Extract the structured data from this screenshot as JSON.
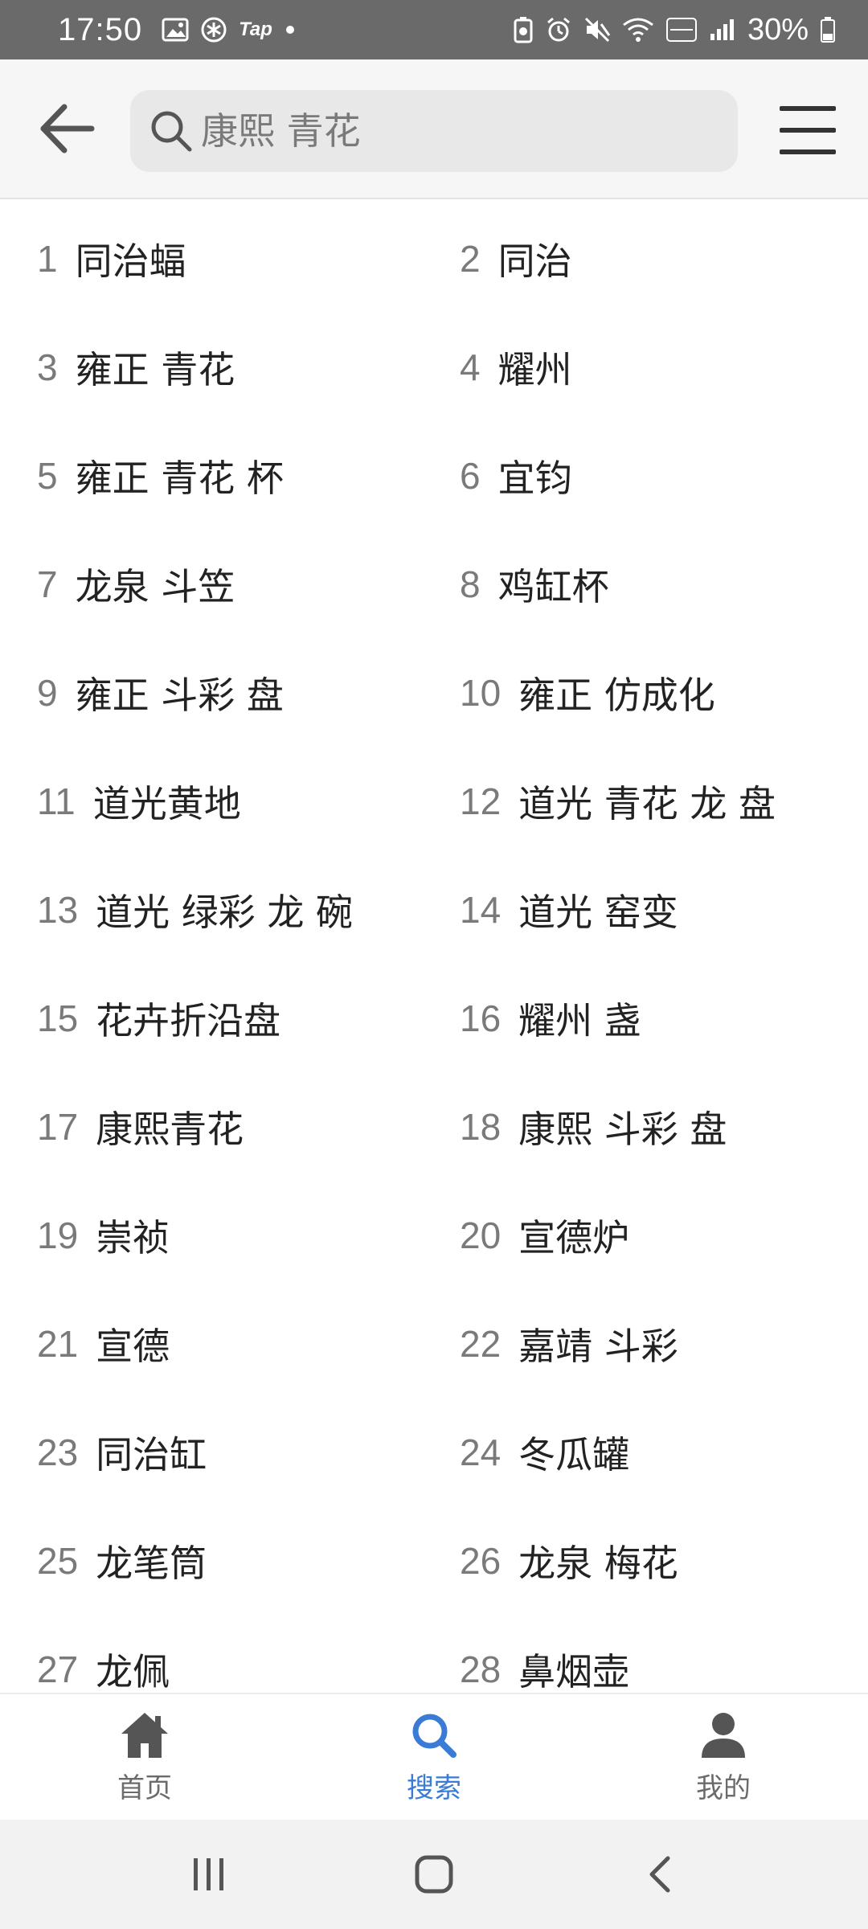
{
  "status_bar": {
    "time": "17:50",
    "tap_label": "Tap",
    "battery": "30%"
  },
  "header": {
    "search_placeholder": "康熙 青花"
  },
  "list": {
    "items": [
      {
        "num": "1",
        "label": "同治蝠"
      },
      {
        "num": "2",
        "label": "同治"
      },
      {
        "num": "3",
        "label": "雍正 青花"
      },
      {
        "num": "4",
        "label": "耀州"
      },
      {
        "num": "5",
        "label": "雍正 青花 杯"
      },
      {
        "num": "6",
        "label": "宜钧"
      },
      {
        "num": "7",
        "label": "龙泉 斗笠"
      },
      {
        "num": "8",
        "label": "鸡缸杯"
      },
      {
        "num": "9",
        "label": "雍正 斗彩 盘"
      },
      {
        "num": "10",
        "label": "雍正 仿成化"
      },
      {
        "num": "11",
        "label": "道光黄地"
      },
      {
        "num": "12",
        "label": "道光 青花 龙 盘"
      },
      {
        "num": "13",
        "label": "道光 绿彩 龙 碗"
      },
      {
        "num": "14",
        "label": "道光 窑变"
      },
      {
        "num": "15",
        "label": "花卉折沿盘"
      },
      {
        "num": "16",
        "label": "耀州 盏"
      },
      {
        "num": "17",
        "label": "康熙青花"
      },
      {
        "num": "18",
        "label": "康熙 斗彩 盘"
      },
      {
        "num": "19",
        "label": "崇祯"
      },
      {
        "num": "20",
        "label": "宣德炉"
      },
      {
        "num": "21",
        "label": "宣德"
      },
      {
        "num": "22",
        "label": "嘉靖 斗彩"
      },
      {
        "num": "23",
        "label": "同治缸"
      },
      {
        "num": "24",
        "label": "冬瓜罐"
      },
      {
        "num": "25",
        "label": "龙笔筒"
      },
      {
        "num": "26",
        "label": "龙泉 梅花"
      },
      {
        "num": "27",
        "label": "龙佩"
      },
      {
        "num": "28",
        "label": "鼻烟壶"
      }
    ]
  },
  "bottom_nav": {
    "home": "首页",
    "search": "搜索",
    "mine": "我的",
    "active": "search"
  },
  "colors": {
    "accent": "#3a7bd5",
    "status_bar": "#6a6a6a",
    "header_bg": "#f6f6f6"
  }
}
